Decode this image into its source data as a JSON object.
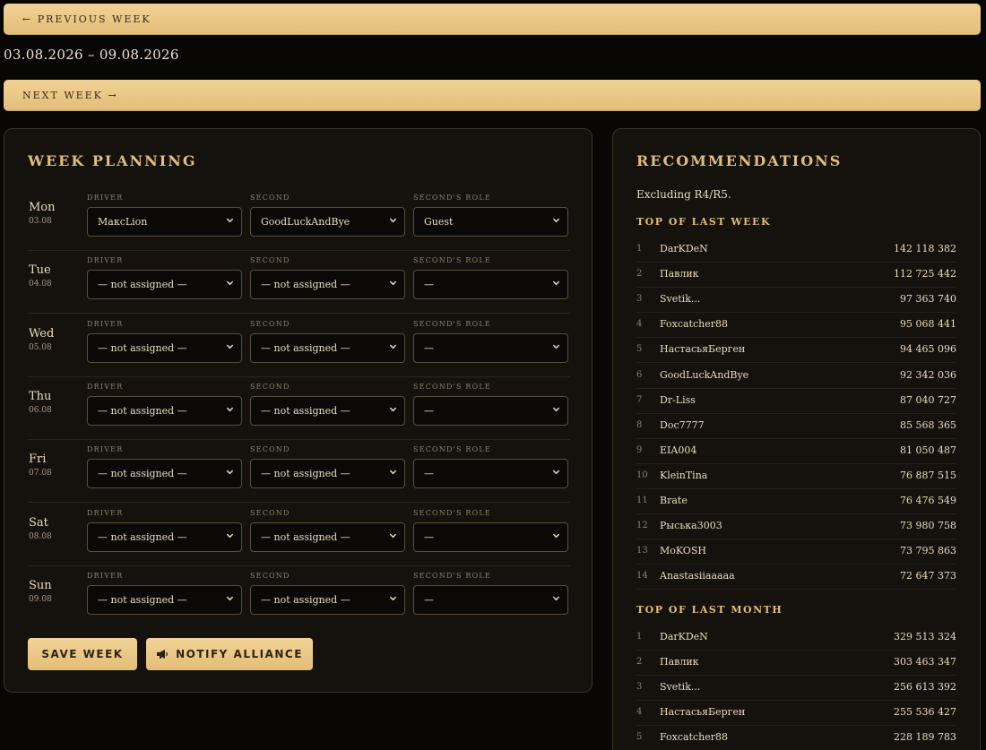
{
  "nav": {
    "prev_label": "← PREVIOUS WEEK",
    "next_label": "NEXT WEEK →",
    "week_range": "03.08.2026 – 09.08.2026"
  },
  "planning": {
    "title": "WEEK PLANNING",
    "labels": {
      "driver": "DRIVER",
      "second": "SECOND",
      "role": "SECOND'S ROLE"
    },
    "days": [
      {
        "name": "Mon",
        "date": "03.08",
        "driver": "MaксLion",
        "second": "GoodLuckAndBye",
        "role": "Guest"
      },
      {
        "name": "Tue",
        "date": "04.08",
        "driver": "— not assigned —",
        "second": "— not assigned —",
        "role": "—"
      },
      {
        "name": "Wed",
        "date": "05.08",
        "driver": "— not assigned —",
        "second": "— not assigned —",
        "role": "—"
      },
      {
        "name": "Thu",
        "date": "06.08",
        "driver": "— not assigned —",
        "second": "— not assigned —",
        "role": "—"
      },
      {
        "name": "Fri",
        "date": "07.08",
        "driver": "— not assigned —",
        "second": "— not assigned —",
        "role": "—"
      },
      {
        "name": "Sat",
        "date": "08.08",
        "driver": "— not assigned —",
        "second": "— not assigned —",
        "role": "—"
      },
      {
        "name": "Sun",
        "date": "09.08",
        "driver": "— not assigned —",
        "second": "— not assigned —",
        "role": "—"
      }
    ],
    "save_label": "SAVE WEEK",
    "notify_label": "NOTIFY ALLIANCE",
    "notify_icon": "megaphone-icon"
  },
  "recommendations": {
    "title": "RECOMMENDATIONS",
    "note": "Excluding R4/R5.",
    "last_week_title": "TOP OF LAST WEEK",
    "last_week": [
      {
        "rank": "1",
        "name": "DarKDeN",
        "score": "142 118 382"
      },
      {
        "rank": "2",
        "name": "Павлик",
        "score": "112 725 442"
      },
      {
        "rank": "3",
        "name": "Svetik...",
        "score": "97 363 740"
      },
      {
        "rank": "4",
        "name": "Foxcatcher88",
        "score": "95 068 441"
      },
      {
        "rank": "5",
        "name": "НастасьяБерген",
        "score": "94 465 096"
      },
      {
        "rank": "6",
        "name": "GoodLuckAndBye",
        "score": "92 342 036"
      },
      {
        "rank": "7",
        "name": "Dr-Liss",
        "score": "87 040 727"
      },
      {
        "rank": "8",
        "name": "Doc7777",
        "score": "85 568 365"
      },
      {
        "rank": "9",
        "name": "EIA004",
        "score": "81 050 487"
      },
      {
        "rank": "10",
        "name": "KleinTina",
        "score": "76 887 515"
      },
      {
        "rank": "11",
        "name": "Brate",
        "score": "76 476 549"
      },
      {
        "rank": "12",
        "name": "Рыська3003",
        "score": "73 980 758"
      },
      {
        "rank": "13",
        "name": "MoKOSH",
        "score": "73 795 863"
      },
      {
        "rank": "14",
        "name": "Anastasiiaaaaa",
        "score": "72 647 373"
      }
    ],
    "last_month_title": "TOP OF LAST MONTH",
    "last_month": [
      {
        "rank": "1",
        "name": "DarKDeN",
        "score": "329 513 324"
      },
      {
        "rank": "2",
        "name": "Павлик",
        "score": "303 463 347"
      },
      {
        "rank": "3",
        "name": "Svetik...",
        "score": "256 613 392"
      },
      {
        "rank": "4",
        "name": "НастасьяБерген",
        "score": "255 536 427"
      },
      {
        "rank": "5",
        "name": "Foxcatcher88",
        "score": "228 189 783"
      }
    ]
  },
  "colors": {
    "background": "#080706",
    "panel": "#15120e",
    "gold": "#e2bd78",
    "heading": "#e0bd80"
  }
}
